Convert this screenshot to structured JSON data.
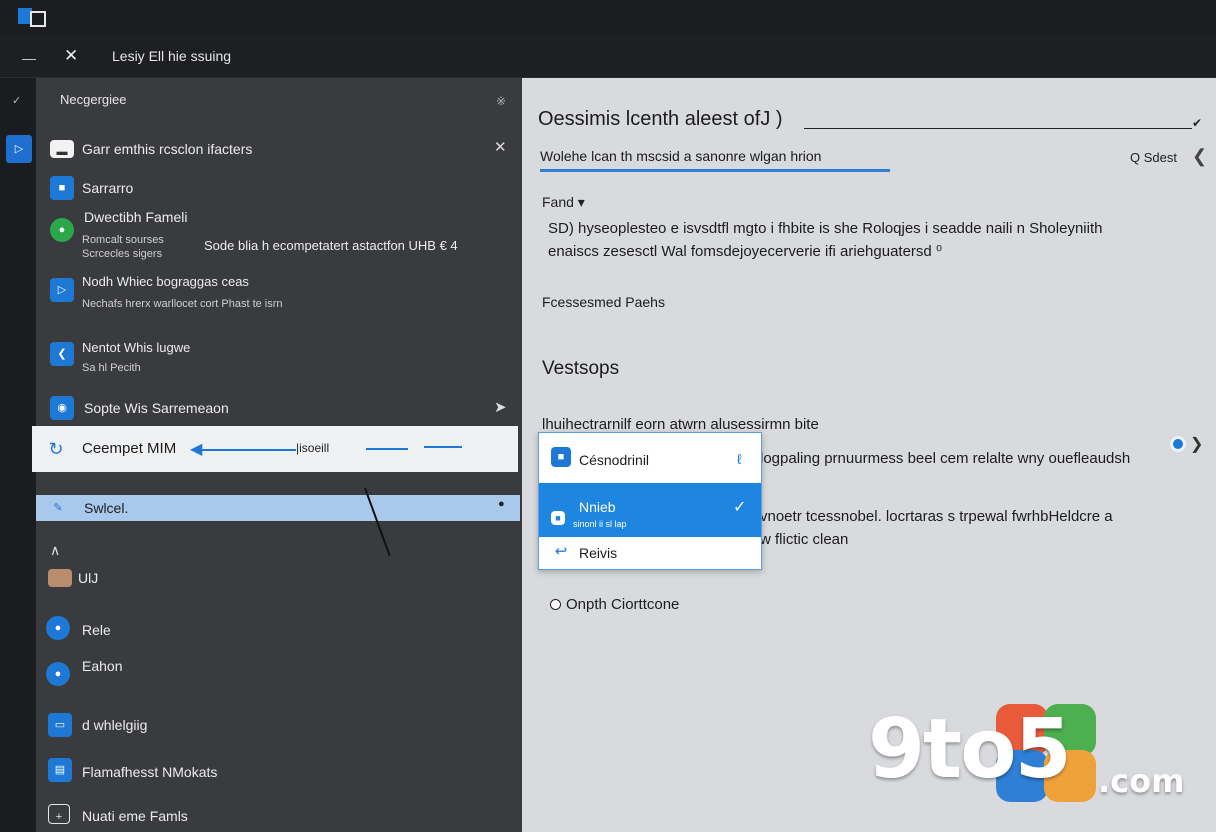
{
  "toolbar": {
    "title": "Lesiy Ell hie ssuing",
    "close_glyph": "✕"
  },
  "sidebar": {
    "header": "Necgergiee",
    "items": [
      {
        "label": "Garr emthis rcsclon ifacters"
      },
      {
        "label": "Sarrarro"
      },
      {
        "label": "Dwectibh Fameli",
        "sub1": "Romcalt sourses",
        "sub2": "Scrcecles sigers",
        "extra": "Sode blia h ecompetatert astactfon UHB € 4"
      },
      {
        "label": "Nodh Whiec bograggas ceas",
        "sub1": "Nechafs hrerx warllocet cort Phast te isrn"
      },
      {
        "label": "Nentot Whis lugwe",
        "sub1": "Sa hl Pecith"
      },
      {
        "label": "Sopte Wis Sarremeaon"
      },
      {
        "label": "Ceempet MIM",
        "sub1": "|isoeill"
      },
      {
        "label": "Swlcel."
      },
      {
        "label": "UlJ"
      },
      {
        "label": "Rele"
      },
      {
        "label": "Eahon"
      },
      {
        "label": "d whlelgiig"
      },
      {
        "label": "Flamafhesst NMokats"
      },
      {
        "label": "Nuati eme Famls"
      }
    ]
  },
  "content": {
    "title": "Oessimis lcenth aleest ofJ )",
    "subtitle": "Wolehe lcan th mscsid a sanonre wlgan hrion",
    "select_label": "Q Sdest",
    "form_label": "Fand",
    "desc_line1": "SD) hyseoplesteo e isvsdtfl mgto i fhbite is she Roloqjes i seadde naili n Sholeyniith",
    "desc_line2": "enaiscs zesesctl Wal fomsdejoyecerverie ifi ariehguatersd ⁰",
    "features": "Fcessesmed Paehs",
    "versions": "Vestsops",
    "info_line": "lhuihectrarnilf eorn atwrn alusessirmn bite",
    "row1": "logpaling prnuurmess beel cem relalte wny ouefleaudsh",
    "row2a": "vnoetr tcessnobel. locrtaras s trpewal fwrhbHeldcre a",
    "row2b": "w flictic clean",
    "option": "Onpth Ciorttcone"
  },
  "dropdown": {
    "items": [
      {
        "label": "Césnodrinil"
      },
      {
        "label": "Nnieb",
        "sub": "sinonl ii sl lap"
      },
      {
        "label": "Reivis"
      }
    ]
  },
  "watermark": {
    "main": "9to5",
    "suffix": ".com"
  },
  "colors": {
    "accent": "#1e78d6",
    "sidebar_bg": "#3a3b3e",
    "content_bg": "#d8dadd",
    "dropdown_selected": "#1e86e0"
  }
}
